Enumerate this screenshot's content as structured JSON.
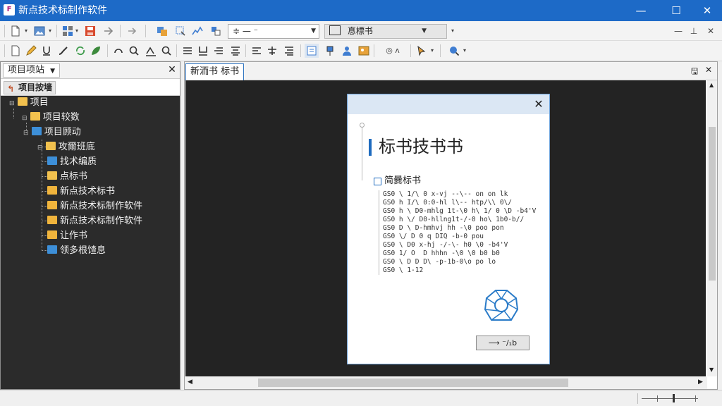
{
  "window": {
    "title": "新点技术标制作软件",
    "controls": {
      "minimize": "—",
      "maximize": "☐",
      "close": "✕"
    }
  },
  "toolbar1": {
    "font_dropdown": {
      "value": "≑  —  ⁻"
    },
    "style_dropdown": {
      "value": "惪標书"
    },
    "right_controls": {
      "minimize": "—",
      "restore": "⊥",
      "close": "✕"
    }
  },
  "toolbar2": {
    "icons": [
      "new-doc",
      "edit",
      "underline-tool",
      "brush",
      "recycle",
      "leaf",
      "undo-arc",
      "zoom",
      "text-baseline",
      "search",
      "align-left",
      "align-u",
      "align-indent",
      "align-center",
      "align-justify",
      "list",
      "list-indent",
      "dialog-tool",
      "pin",
      "user",
      "image",
      "ring-text",
      "dropdown-tool",
      "search-drop"
    ]
  },
  "left_panel": {
    "tab_label": "项目项站",
    "close": "✕",
    "sub_button": "项目按墙",
    "tree": [
      {
        "label": "项目",
        "level": 0
      },
      {
        "label": "项目较数",
        "level": 1
      },
      {
        "label": "项目顾动",
        "level": 2
      },
      {
        "label": "攻爾班底",
        "level": 3
      },
      {
        "label": "找术编质",
        "level": 3
      },
      {
        "label": "点标书",
        "level": 3
      },
      {
        "label": "新点技术标书",
        "level": 3
      },
      {
        "label": "新点技术标制作软件",
        "level": 3
      },
      {
        "label": "新点技术标制作软件",
        "level": 3
      },
      {
        "label": "让作书",
        "level": 3
      },
      {
        "label": "领多根馇息",
        "level": 3
      }
    ]
  },
  "main_panel": {
    "tab_label": "新洏书 标书",
    "panel_icons": {
      "save": "🖫",
      "close": "✕"
    }
  },
  "dialog": {
    "close": "✕",
    "title": "标书技书书",
    "section_label": "简爨标书",
    "lines": [
      "GS0 \\ 1/\\ 0 x-vj --\\-- on on lk",
      "GS0 h I/\\ 0:0-hl l\\-- htp/\\\\ 0\\/",
      "GS0 h \\ D0-mhlg 1t-\\0 h\\ 1/ 0 \\D -b4'V",
      "GS0 h \\/ D0-hllng1t-/-0 ho\\ 1b0-b//",
      "GS0 D \\ D-hmhvj hh -\\0 poo pon",
      "GS0 \\/ D 0 q DIQ -b-0 pou",
      "GS0 \\ D0 x-hj -/-\\- h0 \\0 -b4'V",
      "GS0 1/ O  D hhhn -\\0 \\0 b0 b0",
      "GS0 \\ D D D\\ -p-1b-0\\o po lo",
      "GS0 \\ 1-12"
    ],
    "button_label": "⟶  ⁻/₁b"
  },
  "colors": {
    "titlebar": "#1d6ac7",
    "panel_dark": "#2b2b2b",
    "canvas": "#232323",
    "accent": "#1e6bbf"
  }
}
